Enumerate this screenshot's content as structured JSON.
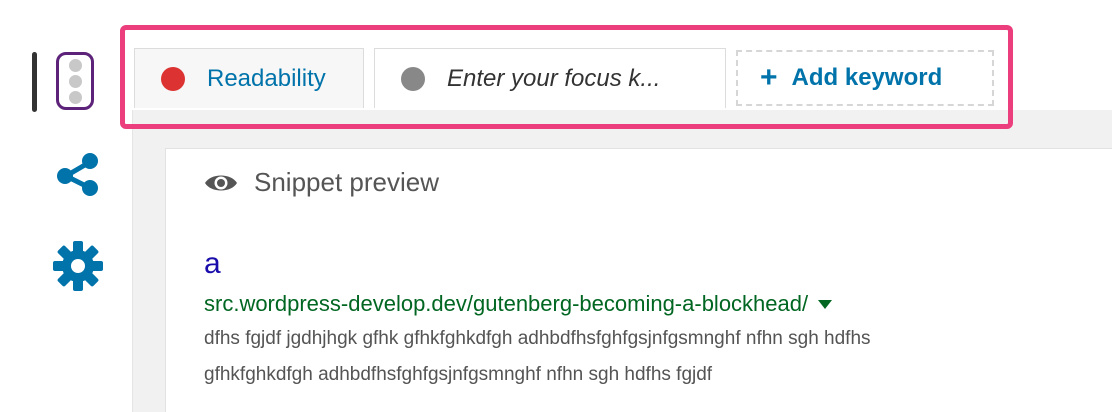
{
  "sidebar": {
    "items": [
      {
        "icon": "traffic-light-icon",
        "active": true
      },
      {
        "icon": "share-icon"
      },
      {
        "icon": "gear-icon"
      }
    ]
  },
  "tabs": [
    {
      "label": "Readability",
      "status_color": "#dc3232"
    },
    {
      "label": "Enter your focus k...",
      "status_color": "#888888"
    }
  ],
  "add_keyword": {
    "label": "Add keyword",
    "icon": "plus-icon"
  },
  "snippet": {
    "header": "Snippet preview",
    "title": "a",
    "url": "src.wordpress-develop.dev/gutenberg-becoming-a-blockhead/",
    "description_lines": [
      "dfhs fgjdf jgdhjhgk gfhk gfhkfghkdfgh adhbdfhsfghfgsjnfgsmnghf nfhn sgh hdfhs",
      "gfhkfghkdfgh adhbdfhsfghfgsjnfgsmnghf nfhn sgh hdfhs fgjdf"
    ]
  },
  "colors": {
    "accent": "#0073aa",
    "highlight": "#ec3e7c",
    "traffic_light_border": "#5d237a",
    "serp_title": "#1a0dab",
    "serp_url": "#006621"
  }
}
